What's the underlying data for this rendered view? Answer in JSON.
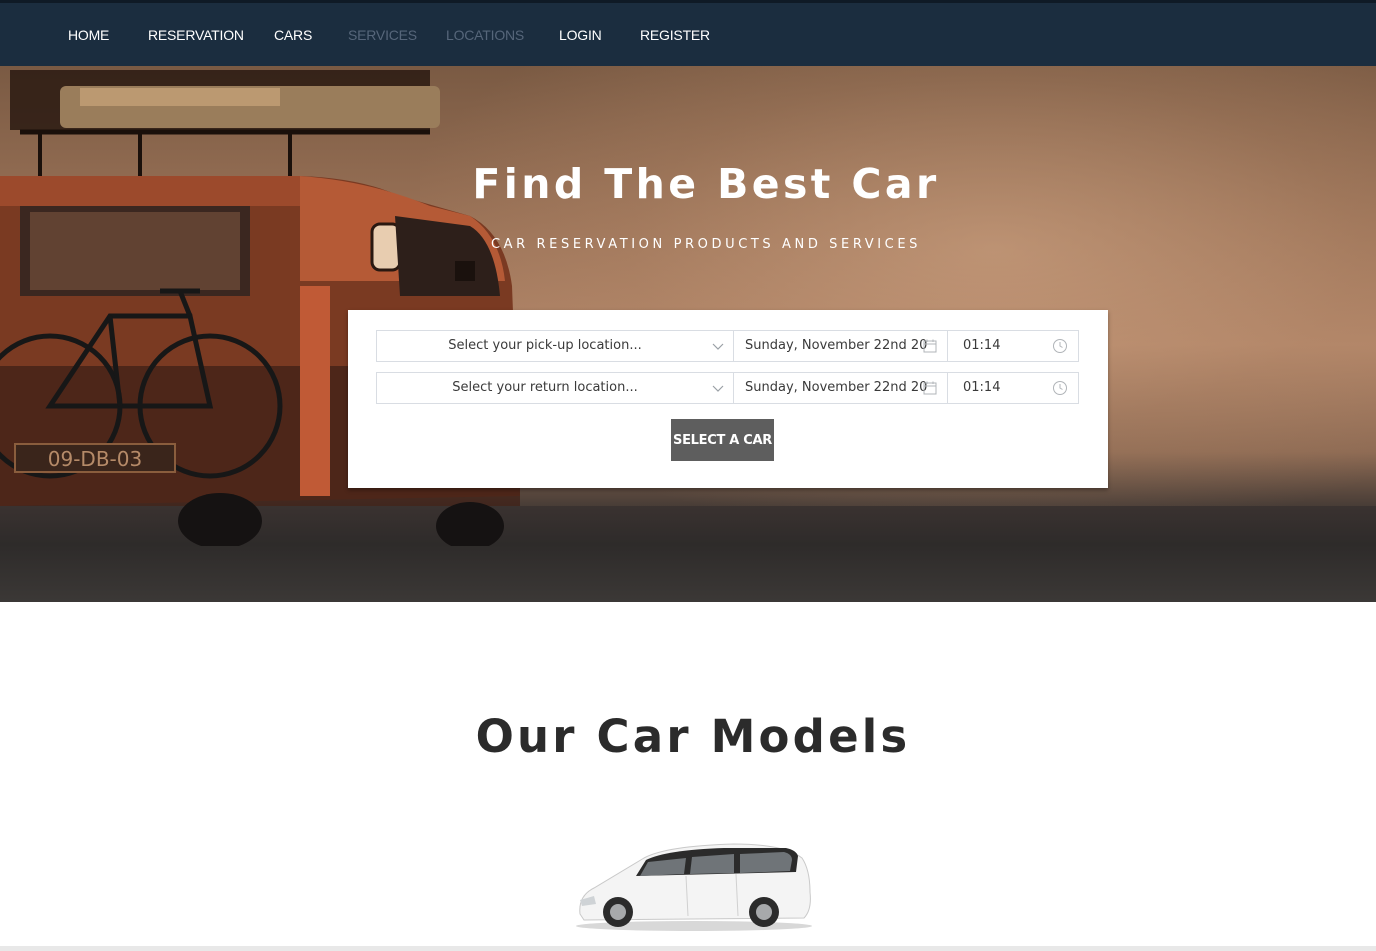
{
  "nav": {
    "items": [
      {
        "label": "HOME"
      },
      {
        "label": "RESERVATION"
      },
      {
        "label": "CARS"
      },
      {
        "label": "SERVICES"
      },
      {
        "label": "LOCATIONS"
      },
      {
        "label": "LOGIN"
      },
      {
        "label": "REGISTER"
      }
    ],
    "background": "#1b2d3f",
    "muted_color": "#56667a"
  },
  "hero": {
    "title": "Find The Best Car",
    "subtitle": "CAR RESERVATION PRODUCTS AND SERVICES",
    "van_plate": "09-DB-03"
  },
  "booking": {
    "pickup": {
      "location_placeholder": "Select your pick-up location...",
      "date": "Sunday, November 22nd 20",
      "time": "01:14"
    },
    "return": {
      "location_placeholder": "Select your return location...",
      "date": "Sunday, November 22nd 20",
      "time": "01:14"
    },
    "submit_label": "SELECT A CAR",
    "button_color": "#5e5e5e"
  },
  "models": {
    "title": "Our Car Models"
  }
}
